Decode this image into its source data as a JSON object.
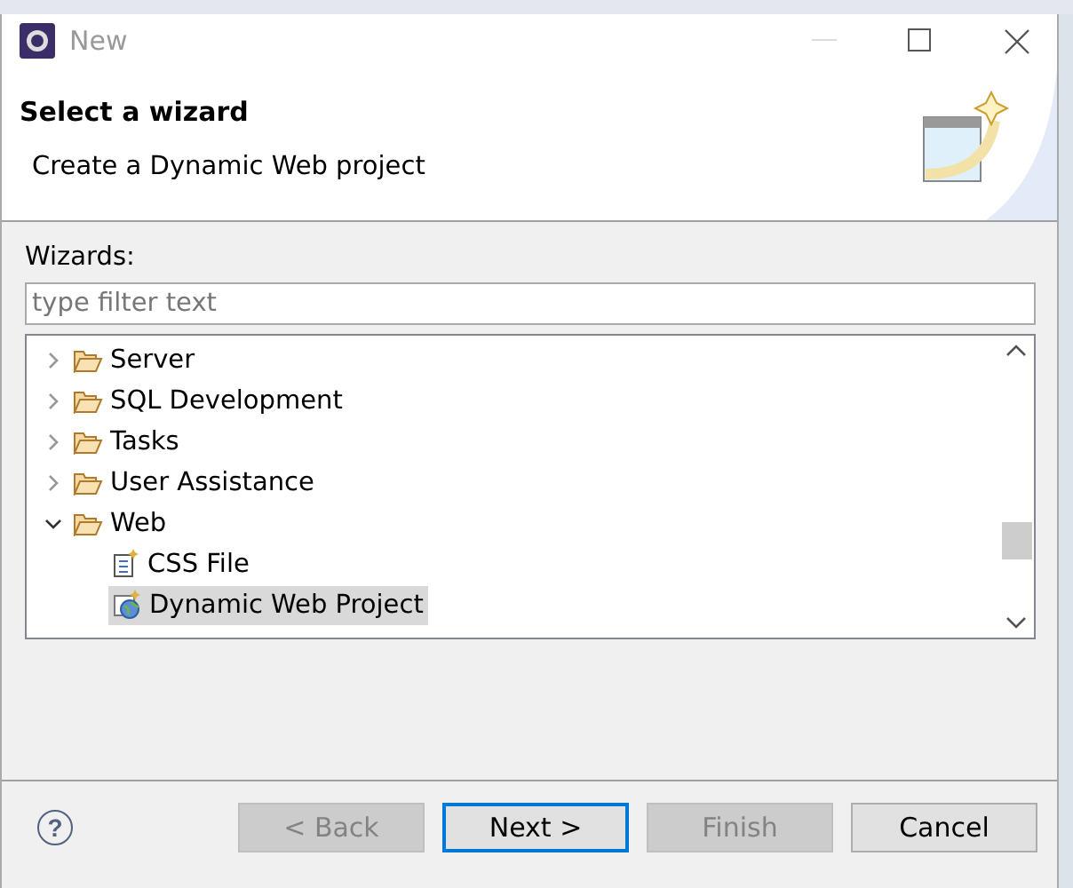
{
  "window": {
    "title": "New",
    "minimize_disabled": true
  },
  "header": {
    "title": "Select a wizard",
    "description": "Create a Dynamic Web project"
  },
  "wizards": {
    "label": "Wizards:",
    "filter": {
      "placeholder": "type filter text"
    },
    "tree": [
      {
        "label": "Server",
        "kind": "folder",
        "expanded": false,
        "selected": false
      },
      {
        "label": "SQL Development",
        "kind": "folder",
        "expanded": false,
        "selected": false
      },
      {
        "label": "Tasks",
        "kind": "folder",
        "expanded": false,
        "selected": false
      },
      {
        "label": "User Assistance",
        "kind": "folder",
        "expanded": false,
        "selected": false
      },
      {
        "label": "Web",
        "kind": "folder",
        "expanded": true,
        "selected": false,
        "children": [
          {
            "label": "CSS File",
            "kind": "css-file",
            "selected": false
          },
          {
            "label": "Dynamic Web Project",
            "kind": "web-project",
            "selected": true
          }
        ]
      }
    ]
  },
  "help": {
    "label": "?"
  },
  "buttons": [
    {
      "label": "< Back",
      "disabled": true,
      "default": false
    },
    {
      "label": "Next >",
      "disabled": false,
      "default": true
    },
    {
      "label": "Finish",
      "disabled": true,
      "default": false
    },
    {
      "label": "Cancel",
      "disabled": false,
      "default": false
    }
  ]
}
